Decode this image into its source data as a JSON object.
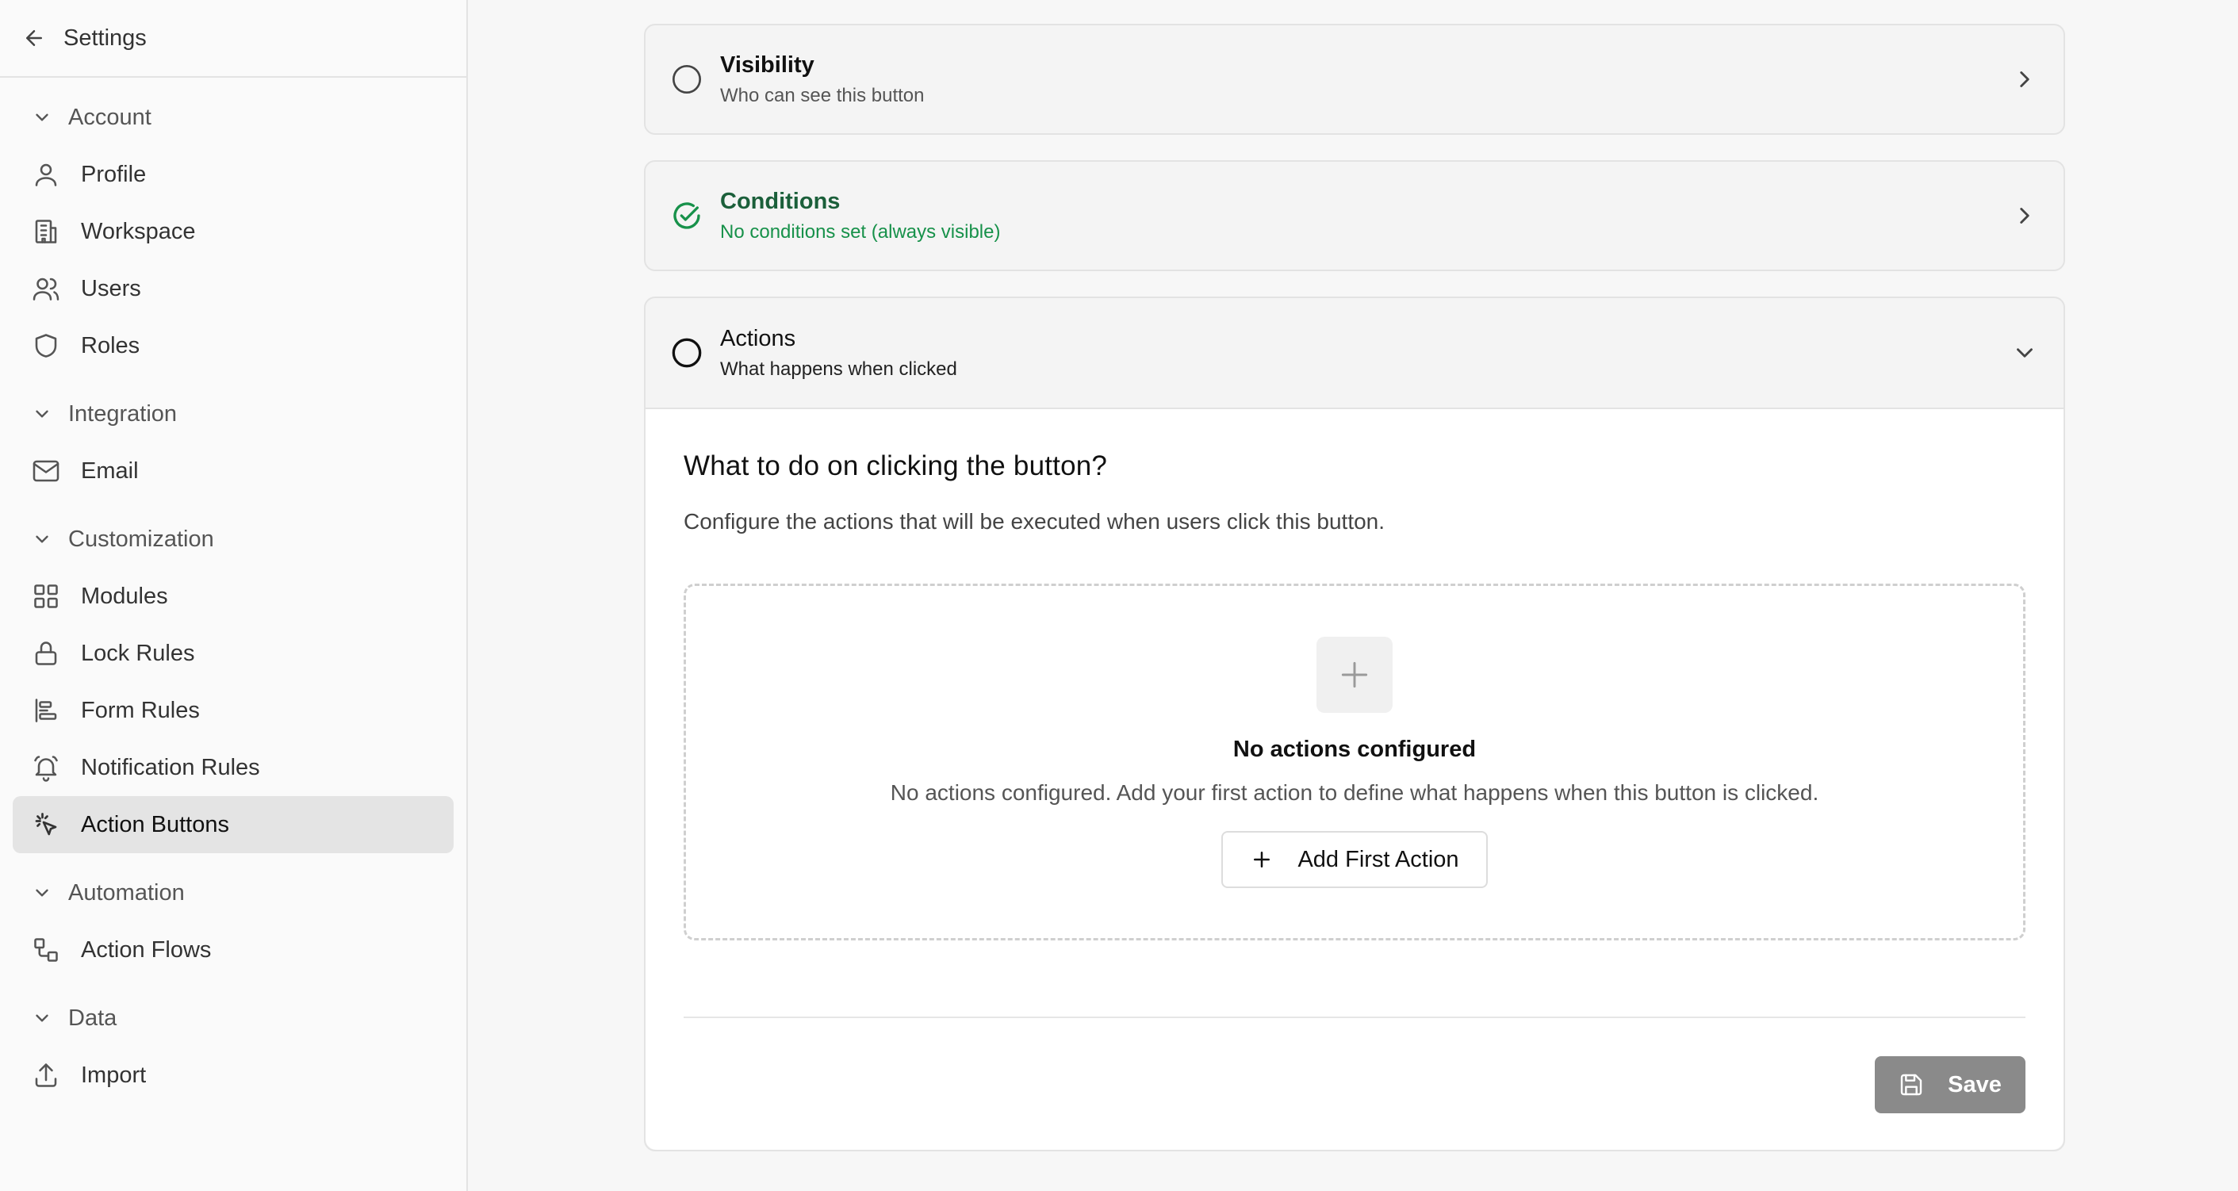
{
  "sidebar": {
    "title": "Settings",
    "sections": [
      {
        "label": "Account",
        "items": [
          {
            "label": "Profile",
            "icon": "user-icon"
          },
          {
            "label": "Workspace",
            "icon": "building-icon"
          },
          {
            "label": "Users",
            "icon": "users-icon"
          },
          {
            "label": "Roles",
            "icon": "shield-icon"
          }
        ]
      },
      {
        "label": "Integration",
        "items": [
          {
            "label": "Email",
            "icon": "mail-icon"
          }
        ]
      },
      {
        "label": "Customization",
        "items": [
          {
            "label": "Modules",
            "icon": "grid-icon"
          },
          {
            "label": "Lock Rules",
            "icon": "lock-icon"
          },
          {
            "label": "Form Rules",
            "icon": "align-left-icon"
          },
          {
            "label": "Notification Rules",
            "icon": "bell-icon"
          },
          {
            "label": "Action Buttons",
            "icon": "pointer-click-icon",
            "active": true
          }
        ]
      },
      {
        "label": "Automation",
        "items": [
          {
            "label": "Action Flows",
            "icon": "workflow-icon"
          }
        ]
      },
      {
        "label": "Data",
        "items": [
          {
            "label": "Import",
            "icon": "upload-icon"
          }
        ]
      }
    ]
  },
  "steps": {
    "visibility": {
      "title": "Visibility",
      "subtitle": "Who can see this button",
      "status": "incomplete"
    },
    "conditions": {
      "title": "Conditions",
      "subtitle": "No conditions set (always visible)",
      "status": "complete"
    },
    "actions": {
      "title": "Actions",
      "subtitle": "What happens when clicked",
      "status": "incomplete",
      "expanded": true
    }
  },
  "actions_panel": {
    "heading": "What to do on clicking the button?",
    "description": "Configure the actions that will be executed when users click this button.",
    "empty_title": "No actions configured",
    "empty_description": "No actions configured. Add your first action to define what happens when this button is clicked.",
    "add_button_label": "Add First Action",
    "save_label": "Save"
  },
  "colors": {
    "success": "#17914a",
    "active_bg": "#e4e4e4",
    "save_disabled": "#8a8a8a"
  }
}
